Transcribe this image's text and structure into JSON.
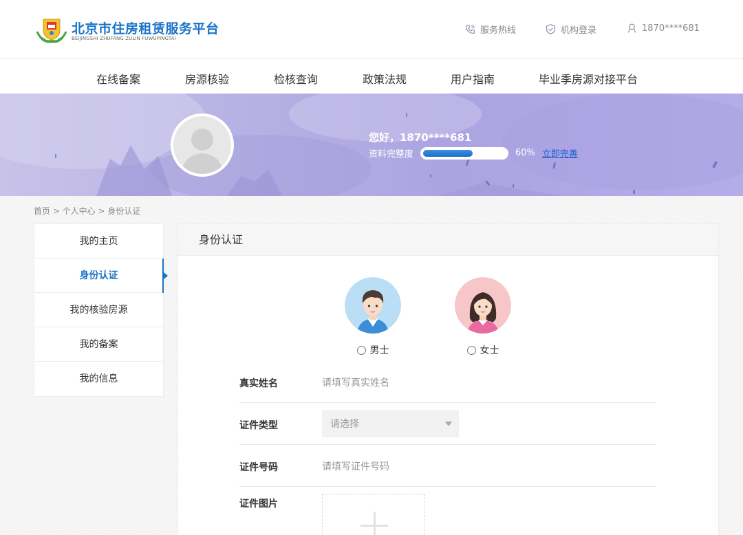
{
  "header": {
    "brand_title": "北京市住房租赁服务平台",
    "brand_subtitle": "BEIJINGSHI ZHUFANG ZULIN FUWUPINGTAI",
    "hotline_label": "服务热线",
    "org_login_label": "机构登录",
    "user_label": "1870****681"
  },
  "nav": {
    "items": [
      "在线备案",
      "房源核验",
      "检核查询",
      "政策法规",
      "用户指南",
      "毕业季房源对接平台"
    ]
  },
  "banner": {
    "greeting": "您好，1870****681",
    "profile_label": "资料完整度",
    "progress_value": 0.6,
    "progress_text": "60%",
    "complete_link": "立即完善"
  },
  "breadcrumb": "首页 > 个人中心 > 身份认证",
  "sidebar": {
    "items": [
      {
        "label": "我的主页",
        "active": false
      },
      {
        "label": "身份认证",
        "active": true
      },
      {
        "label": "我的核验房源",
        "active": false
      },
      {
        "label": "我的备案",
        "active": false
      },
      {
        "label": "我的信息",
        "active": false
      }
    ]
  },
  "panel": {
    "title": "身份认证",
    "gender": {
      "male": "男士",
      "female": "女士"
    },
    "form": {
      "name_label": "真实姓名",
      "name_placeholder": "请填写真实姓名",
      "id_type_label": "证件类型",
      "id_type_placeholder": "请选择",
      "id_number_label": "证件号码",
      "id_number_placeholder": "请填写证件号码",
      "id_image_label": "证件图片"
    }
  },
  "colors": {
    "brand_blue": "#1a73c8",
    "banner_purple": "#b0a9e5"
  },
  "icons": [
    "logo-emblem-icon",
    "phone-icon",
    "shield-check-icon",
    "user-icon",
    "male-avatar-icon",
    "female-avatar-icon",
    "plus-icon"
  ]
}
